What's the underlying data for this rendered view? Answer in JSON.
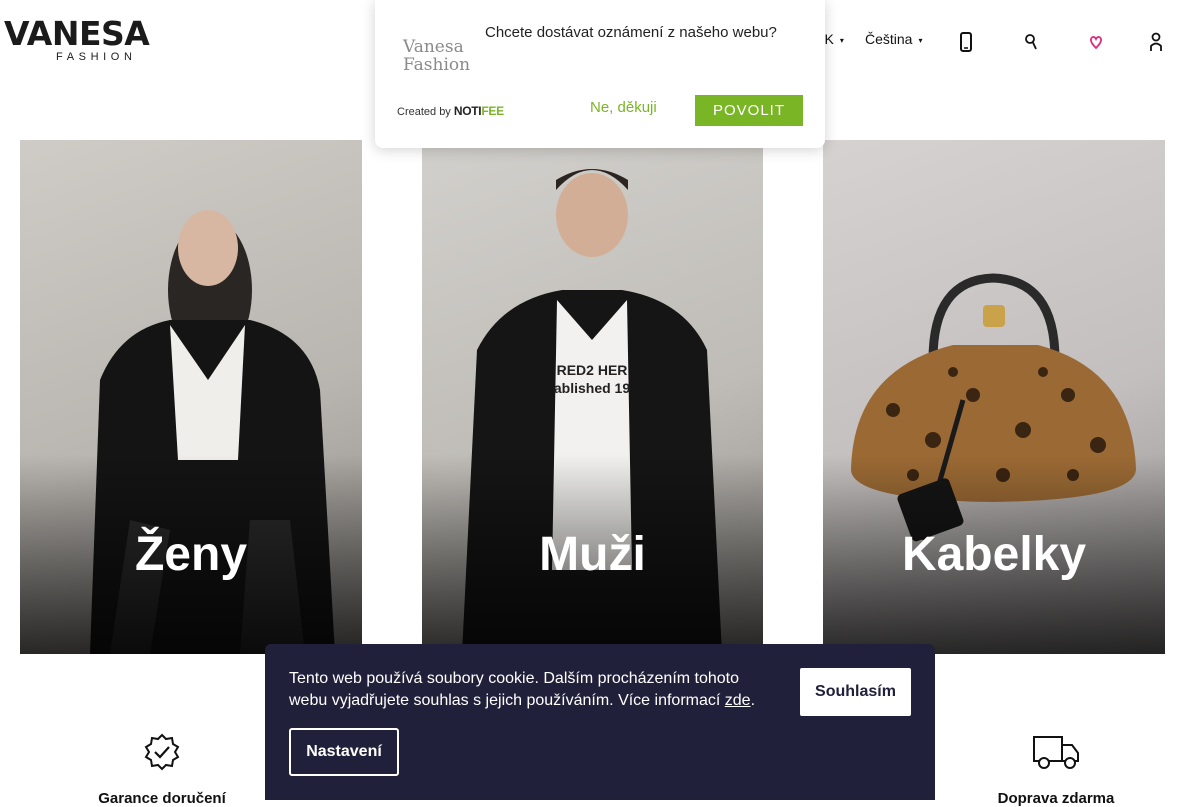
{
  "header": {
    "logo_main": "VANESA",
    "logo_sub": "FASHION",
    "currency": "ZK",
    "language": "Čeština",
    "icons": [
      "phone-icon",
      "search-icon",
      "heart-icon",
      "user-icon"
    ],
    "accent_color": "#e0287a"
  },
  "banners": [
    {
      "label": "Ženy"
    },
    {
      "label": "Muži"
    },
    {
      "label": "Kabelky"
    }
  ],
  "features": [
    {
      "title": "Garance doručení",
      "icon": "verified-badge-icon"
    },
    {
      "title": "Doprava zdarma",
      "icon": "delivery-truck-icon"
    }
  ],
  "notification": {
    "logo_line1": "Vanesa",
    "logo_line2": "Fashion",
    "question": "Chcete dostávat oznámení z našeho webu?",
    "created_by": "Created by",
    "brand_a": "NOTI",
    "brand_b": "FEE",
    "deny_label": "Ne, děkuji",
    "allow_label": "POVOLIT",
    "accent_color": "#7ab526"
  },
  "cookie": {
    "text_before": "Tento web používá soubory cookie. Dalším procházením tohoto webu vyjadřujete souhlas s jejich používáním. Více informací ",
    "link_label": "zde",
    "text_after": ".",
    "accept_label": "Souhlasím",
    "settings_label": "Nastavení",
    "bg_color": "#21203a"
  }
}
